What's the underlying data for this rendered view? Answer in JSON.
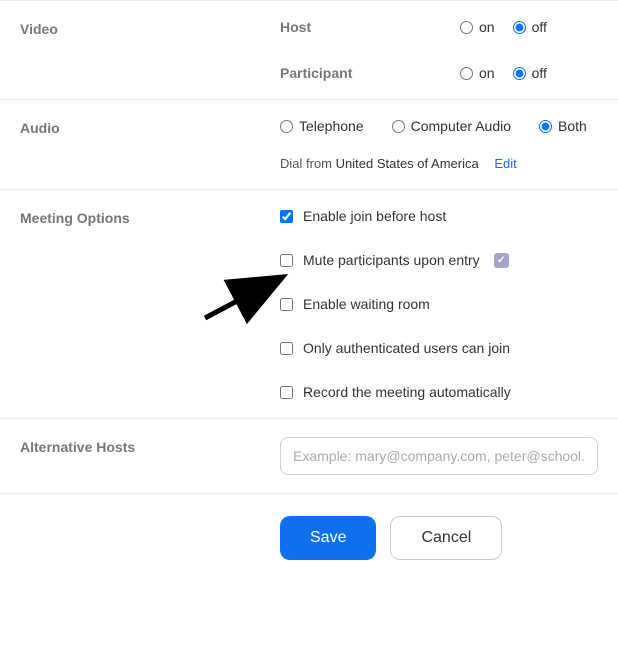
{
  "video": {
    "label": "Video",
    "host": {
      "label": "Host",
      "on": "on",
      "off": "off",
      "value": "off"
    },
    "participant": {
      "label": "Participant",
      "on": "on",
      "off": "off",
      "value": "off"
    }
  },
  "audio": {
    "label": "Audio",
    "options": {
      "telephone": "Telephone",
      "computer": "Computer Audio",
      "both": "Both"
    },
    "value": "both",
    "dial_from_prefix": "Dial from",
    "dial_from_region": "United States of America",
    "edit_label": "Edit"
  },
  "meeting_options": {
    "label": "Meeting Options",
    "items": [
      {
        "label": "Enable join before host",
        "checked": true,
        "info": false
      },
      {
        "label": "Mute participants upon entry",
        "checked": false,
        "info": true
      },
      {
        "label": "Enable waiting room",
        "checked": false,
        "info": false
      },
      {
        "label": "Only authenticated users can join",
        "checked": false,
        "info": false
      },
      {
        "label": "Record the meeting automatically",
        "checked": false,
        "info": false
      }
    ]
  },
  "alternative_hosts": {
    "label": "Alternative Hosts",
    "placeholder": "Example: mary@company.com, peter@school.edu",
    "value": ""
  },
  "buttons": {
    "save": "Save",
    "cancel": "Cancel"
  }
}
